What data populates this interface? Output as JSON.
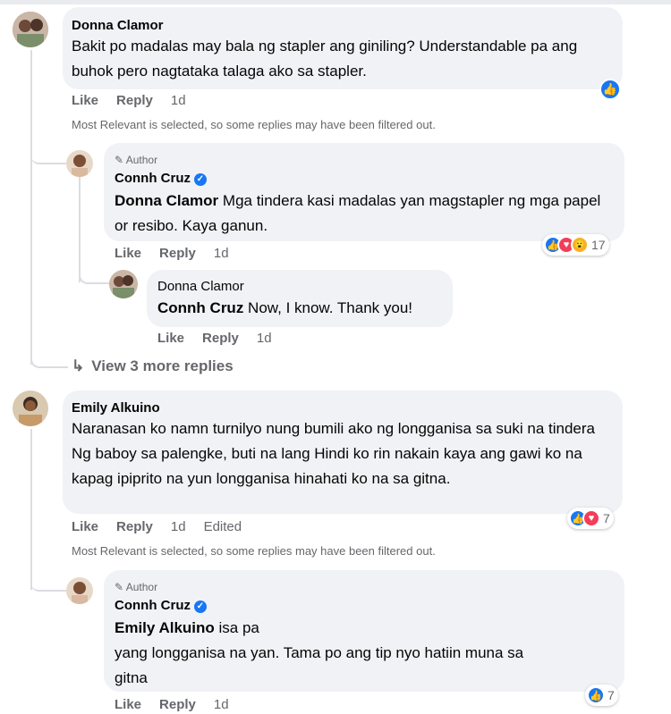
{
  "actions": {
    "like": "Like",
    "reply": "Reply"
  },
  "comments": [
    {
      "author": "Donna Clamor",
      "text": "Bakit po madalas may bala ng stapler ang giniling? Understandable pa ang buhok pero nagtataka talaga ako sa stapler.",
      "time": "1d",
      "reaction_count": "",
      "filter_notice": "Most Relevant is selected, so some replies may have been filtered out.",
      "replies": [
        {
          "author_badge": "Author",
          "author": "Connh Cruz",
          "mention": "Donna Clamor",
          "text": " Mga tindera kasi madalas yan magstapler ng mga papel or resibo. Kaya ganun.",
          "time": "1d",
          "reaction_count": "17"
        },
        {
          "author": "Donna Clamor",
          "mention": "Connh Cruz",
          "text": " Now, I know. Thank you!",
          "time": "1d"
        }
      ],
      "view_more": "View 3 more replies"
    },
    {
      "author": "Emily Alkuino",
      "text": "Naranasan ko namn turnilyo nung bumili ako ng longganisa sa suki na tindera Ng baboy sa palengke, buti na lang Hindi ko rin nakain kaya ang gawi ko na kapag ipiprito na yun longganisa hinahati ko na sa gitna.",
      "time": "1d",
      "edited": "Edited",
      "reaction_count": "7",
      "filter_notice": "Most Relevant is selected, so some replies may have been filtered out.",
      "replies": [
        {
          "author_badge": "Author",
          "author": "Connh Cruz",
          "mention": "Emily Alkuino",
          "text_line1": " isa pa",
          "text_line2": "yang longganisa na yan. Tama po ang tip nyo hatiin muna sa",
          "text_line3": "gitna",
          "time": "1d",
          "reaction_count": "7"
        }
      ]
    }
  ],
  "icons": {
    "like": "thumbs-up-icon",
    "love": "heart-icon",
    "wow": "wow-icon",
    "author_badge": "pencil-icon",
    "verified": "verified-badge-icon",
    "view_more": "reply-arrow-icon"
  },
  "colors": {
    "like": "#1877f2",
    "love": "#f33e58",
    "wow": "#f7b125",
    "bubble": "#f0f2f5",
    "muted": "#65676b"
  }
}
